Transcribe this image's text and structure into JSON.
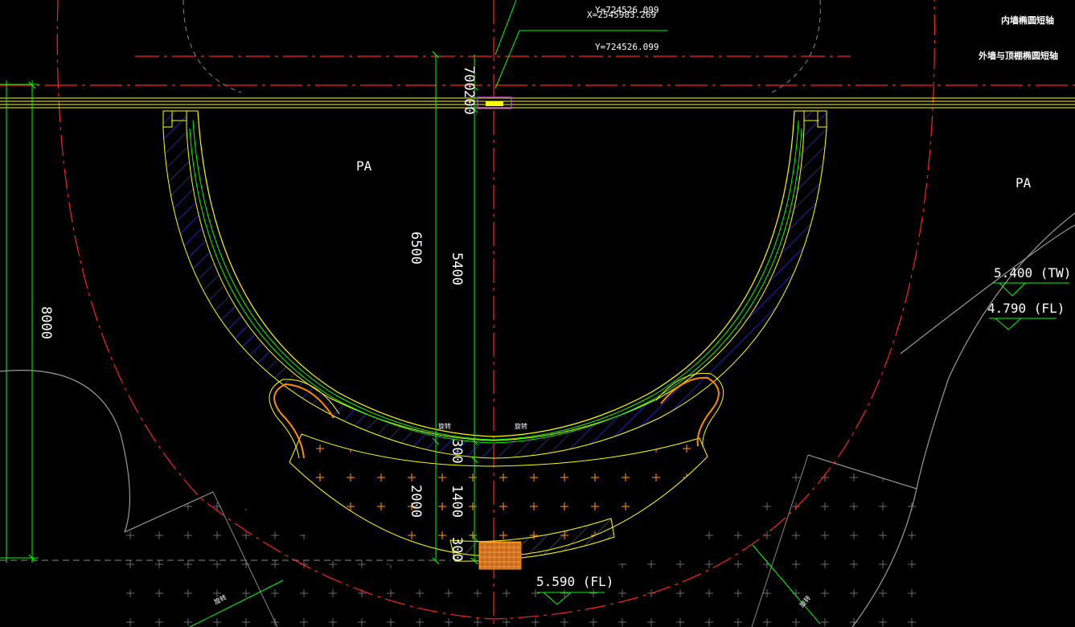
{
  "drawing": {
    "coordinates": {
      "y_top": "Y=724526.099",
      "x_overlap": "X=2545983.269",
      "y_second": "Y=724526.099"
    },
    "legend_labels": {
      "inner_wall_axis": "内墙椭圆短轴",
      "outer_wall_axis": "外墙与顶棚椭圆短轴"
    },
    "zone_labels": {
      "pa_left": "PA",
      "pa_right": "PA"
    },
    "dimensions": {
      "d700": "700",
      "d200": "200",
      "d6500": "6500",
      "d5400": "5400",
      "d8000": "8000",
      "d300_mid": "300",
      "d2000": "2000",
      "d1400": "1400",
      "d300_bottom": "300"
    },
    "levels": {
      "tw": "5.400 (TW)",
      "fl_right": "4.790 (FL)",
      "fl_bottom": "5.590 (FL)"
    },
    "small_tags": {
      "tag_a": "旋转",
      "tag_b": "旋转",
      "tag_c": "旋转",
      "tag_d": "旋转"
    },
    "colors": {
      "background": "#000000",
      "wall_outline": "#ffff00",
      "axis_red": "#ff2020",
      "dimension_green": "#00ff00",
      "hatch_blue": "#3a3aff",
      "planter_orange": "#ff8c00",
      "grid_gray": "#8a8a8a"
    }
  }
}
